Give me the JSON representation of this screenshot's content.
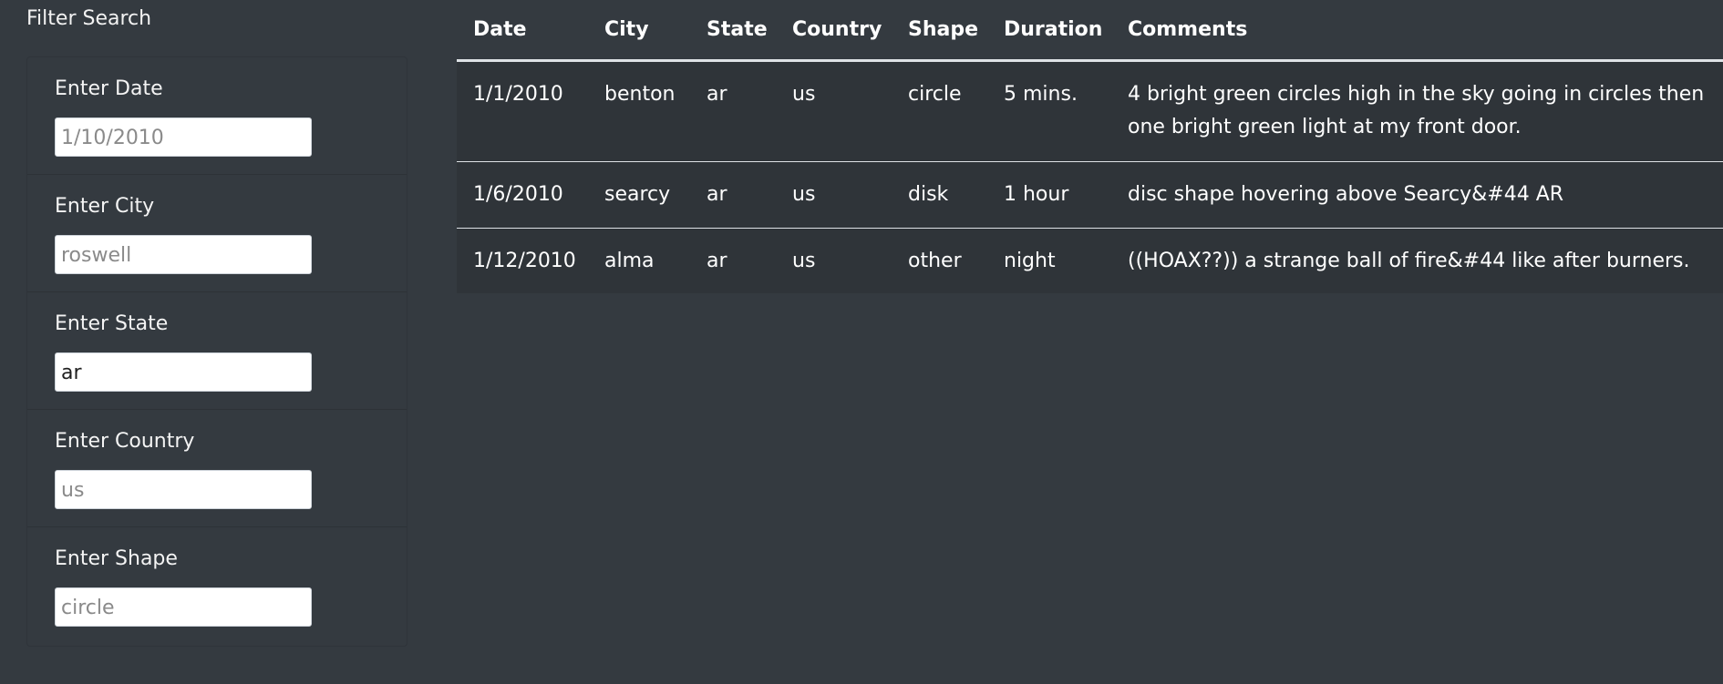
{
  "sidebar": {
    "title": "Filter Search",
    "filters": [
      {
        "label": "Enter Date",
        "value": "",
        "placeholder": "1/10/2010"
      },
      {
        "label": "Enter City",
        "value": "",
        "placeholder": "roswell"
      },
      {
        "label": "Enter State",
        "value": "ar",
        "placeholder": ""
      },
      {
        "label": "Enter Country",
        "value": "",
        "placeholder": "us"
      },
      {
        "label": "Enter Shape",
        "value": "",
        "placeholder": "circle"
      }
    ]
  },
  "table": {
    "headers": [
      "Date",
      "City",
      "State",
      "Country",
      "Shape",
      "Duration",
      "Comments"
    ],
    "rows": [
      [
        "1/1/2010",
        "benton",
        "ar",
        "us",
        "circle",
        "5 mins.",
        "4 bright green circles high in the sky going in circles then one bright green light at my front door."
      ],
      [
        "1/6/2010",
        "searcy",
        "ar",
        "us",
        "disk",
        "1 hour",
        "disc shape hovering above Searcy&#44 AR"
      ],
      [
        "1/12/2010",
        "alma",
        "ar",
        "us",
        "other",
        "night",
        "((HOAX??)) a strange ball of fire&#44 like after burners."
      ]
    ]
  }
}
